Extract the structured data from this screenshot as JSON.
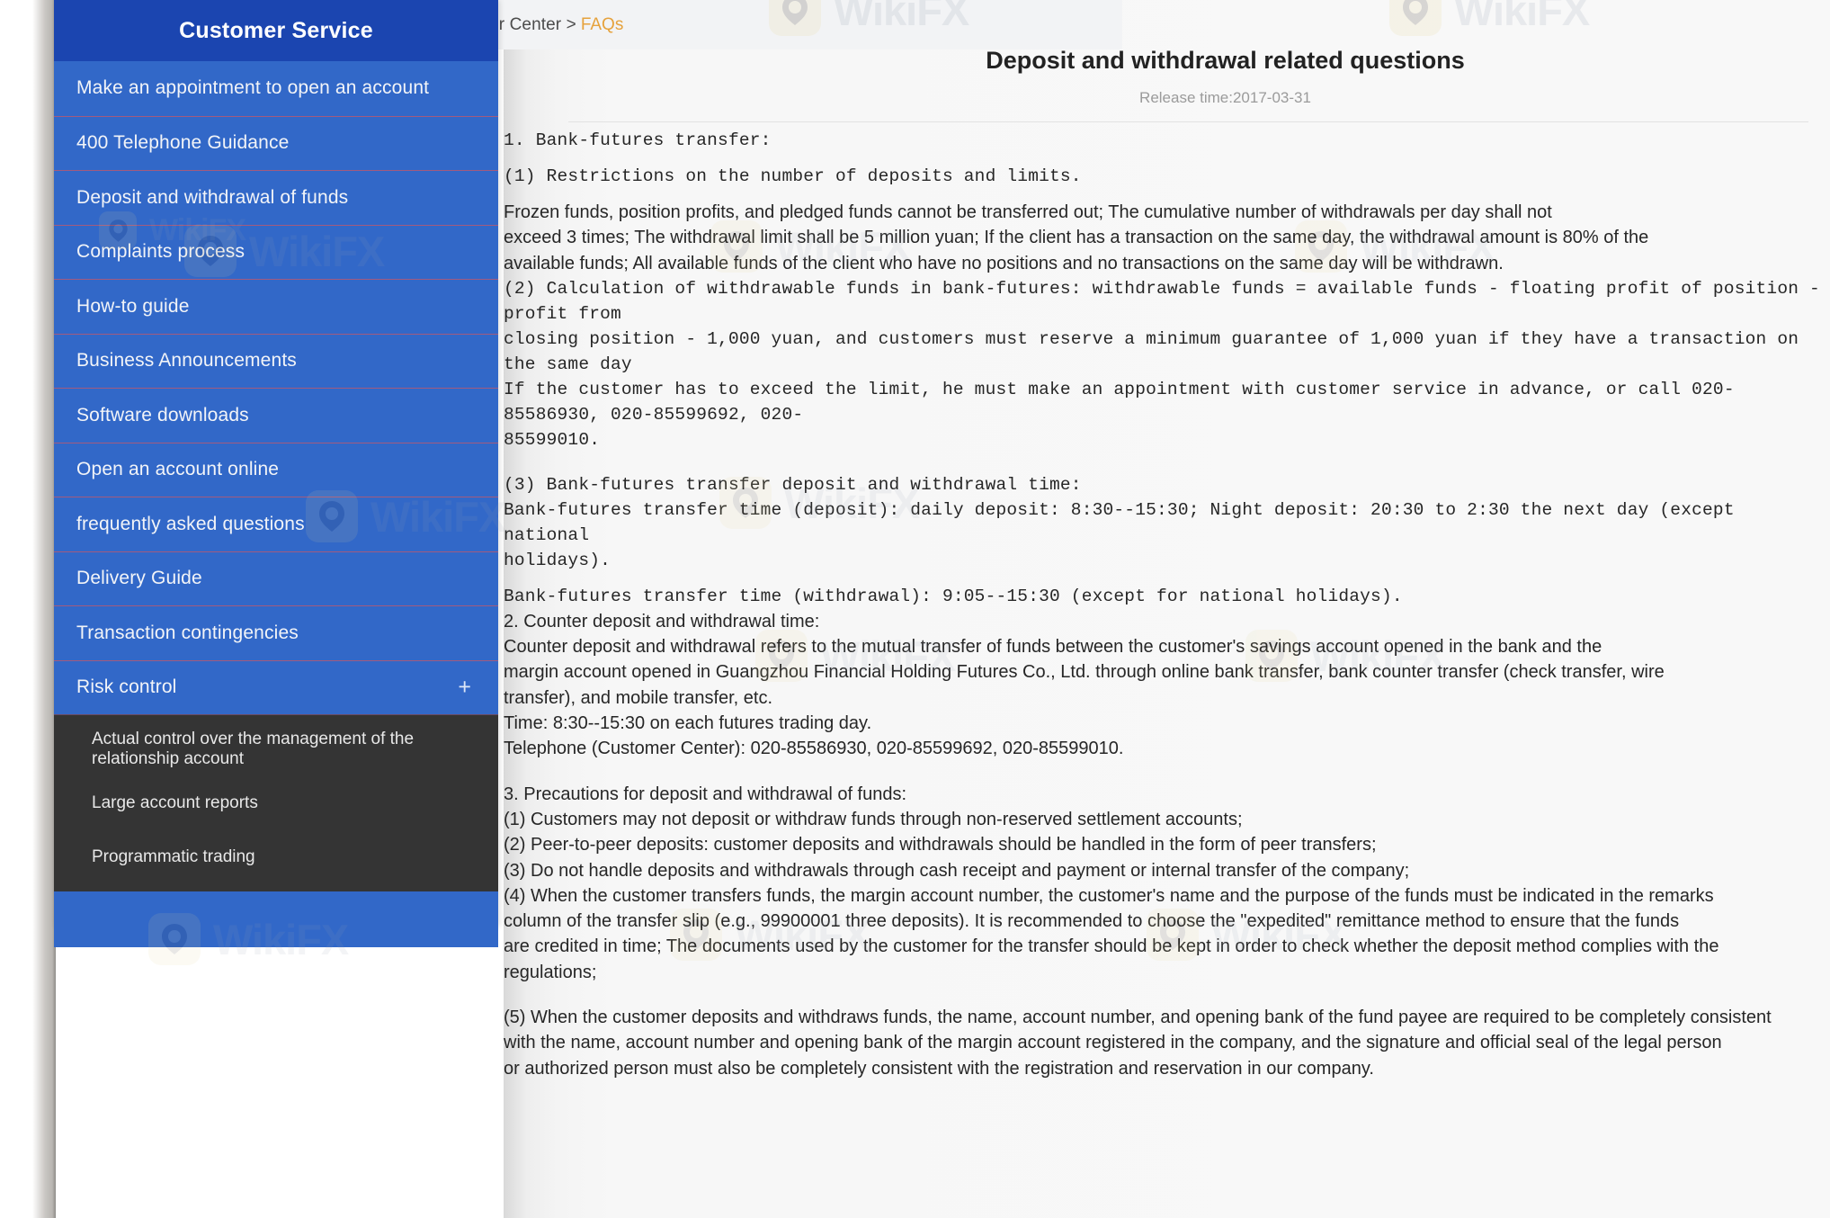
{
  "breadcrumb": {
    "prefix": "You are here: Customer Center >",
    "current": "FAQs"
  },
  "article": {
    "title": "Deposit and withdrawal related questions",
    "release": "Release time:2017-03-31",
    "paragraphs": [
      {
        "style": "mono",
        "text": "1. Bank-futures transfer:"
      },
      {
        "style": "mono",
        "text": "(1) Restrictions on the number of deposits and limits."
      },
      {
        "style": "sans",
        "text": "Frozen funds, position profits, and pledged funds cannot be transferred out; The cumulative number of withdrawals per day shall not"
      },
      {
        "style": "sans",
        "text": "exceed 3 times; The withdrawal limit shall be 5 million yuan; If the client has a transaction on the same day, the withdrawal amount is 80% of the"
      },
      {
        "style": "sans",
        "text": "available funds; All available funds of the client who have no positions and no transactions on the same day will be withdrawn."
      },
      {
        "style": "mono",
        "text": "(2) Calculation of withdrawable funds in bank-futures: withdrawable funds = available funds - floating profit of position - profit from"
      },
      {
        "style": "mono",
        "text": "closing position - 1,000 yuan, and customers must reserve a minimum guarantee of 1,000 yuan if they have a transaction on the same day"
      },
      {
        "style": "mono",
        "text": "If the customer has to exceed the limit, he must make an appointment with customer service in advance, or call 020-85586930, 020-85599692, 020-"
      },
      {
        "style": "mono",
        "text": "85599010."
      },
      {
        "style": "mono",
        "text": "(3) Bank-futures transfer deposit and withdrawal time:"
      },
      {
        "style": "mono",
        "text": "Bank-futures transfer time (deposit): daily deposit: 8:30--15:30; Night deposit: 20:30 to 2:30 the next day (except national"
      },
      {
        "style": "mono",
        "text": "holidays)."
      },
      {
        "style": "mono",
        "text": "Bank-futures transfer time (withdrawal): 9:05--15:30 (except for national holidays)."
      },
      {
        "style": "sans",
        "text": "2. Counter deposit and withdrawal time:"
      },
      {
        "style": "sans",
        "text": "Counter deposit and withdrawal refers to the mutual transfer of funds between the customer's savings account opened in the bank and the"
      },
      {
        "style": "sans",
        "text": "margin account opened in Guangzhou Financial Holding Futures Co., Ltd. through online bank transfer, bank counter transfer (check transfer, wire"
      },
      {
        "style": "sans",
        "text": "transfer), and mobile transfer, etc."
      },
      {
        "style": "sans",
        "text": "Time: 8:30--15:30 on each futures trading day."
      },
      {
        "style": "sans",
        "text": "Telephone (Customer Center): 020-85586930, 020-85599692, 020-85599010."
      },
      {
        "style": "sans",
        "text": "3. Precautions for deposit and withdrawal of funds:"
      },
      {
        "style": "sans",
        "text": "(1) Customers may not deposit or withdraw funds through non-reserved settlement accounts;"
      },
      {
        "style": "sans",
        "text": "(2) Peer-to-peer deposits: customer deposits and withdrawals should be handled in the form of peer transfers;"
      },
      {
        "style": "sans",
        "text": "(3) Do not handle deposits and withdrawals through cash receipt and payment or internal transfer of the company;"
      },
      {
        "style": "sans",
        "text": "(4) When the customer transfers funds, the margin account number, the customer's name and the purpose of the funds must be indicated in the remarks"
      },
      {
        "style": "sans",
        "text": "column of the transfer slip (e.g., 99900001 three deposits). It is recommended to choose the \"expedited\" remittance method to ensure that the funds"
      },
      {
        "style": "sans",
        "text": "are credited in time; The documents used by the customer for the transfer should be kept in order to check whether the deposit method complies with the"
      },
      {
        "style": "sans",
        "text": "regulations;"
      },
      {
        "style": "sans",
        "text": "(5) When the customer deposits and withdraws funds, the name, account number, and opening bank of the fund payee are required to be completely consistent"
      },
      {
        "style": "sans",
        "text": "with the name, account number and opening bank of the margin account registered in the company, and the signature and official seal of the legal person"
      },
      {
        "style": "sans",
        "text": "or authorized person must also be completely consistent with the registration and reservation in our company."
      }
    ]
  },
  "sidebar": {
    "header": "Customer Service",
    "items": [
      {
        "label": "Make an appointment to open an account",
        "expand": ""
      },
      {
        "label": "400 Telephone Guidance",
        "expand": ""
      },
      {
        "label": "Deposit and withdrawal of funds",
        "expand": ""
      },
      {
        "label": "Complaints process",
        "expand": ""
      },
      {
        "label": "How-to guide",
        "expand": ""
      },
      {
        "label": "Business Announcements",
        "expand": ""
      },
      {
        "label": "Software downloads",
        "expand": ""
      },
      {
        "label": "Open an account online",
        "expand": ""
      },
      {
        "label": "frequently asked questions",
        "expand": ""
      },
      {
        "label": "Delivery Guide",
        "expand": ""
      },
      {
        "label": "Transaction contingencies",
        "expand": ""
      },
      {
        "label": "Risk control",
        "expand": "+"
      }
    ],
    "submenu": [
      {
        "label": "Actual control over the management of the relationship account"
      },
      {
        "label": "Large account reports"
      },
      {
        "label": "Programmatic trading"
      }
    ]
  },
  "watermark": {
    "text": "WikiFX",
    "icon": "wikifx-eagle-icon"
  },
  "colors": {
    "sidebar_blue": "#3268c8",
    "sidebar_header_blue": "#1b45b0",
    "submenu_dark": "#343434",
    "breadcrumb_accent": "#e6a23c"
  }
}
